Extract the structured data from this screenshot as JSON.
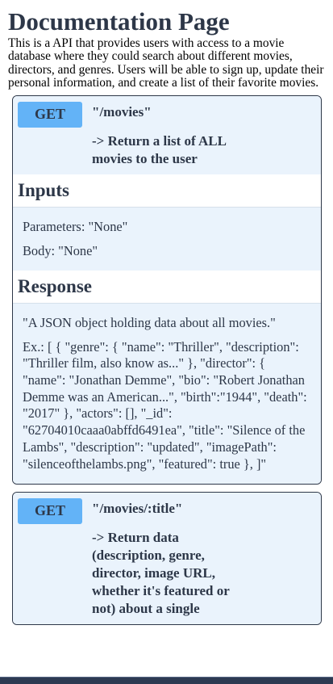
{
  "page": {
    "title": "Documentation Page",
    "intro": "This is a API that provides users with access to a movie database where they could search about different movies, directors, and genres. Users will be able to sign up, update their personal information, and create a list of their favorite movies."
  },
  "endpoints": [
    {
      "method": "GET",
      "path": "\"/movies\"",
      "description": "-> Return a list of ALL movies to the user",
      "inputs": {
        "title": "Inputs",
        "parameters": "Parameters: \"None\"",
        "body": "Body: \"None\""
      },
      "response": {
        "title": "Response",
        "summary": "\"A JSON object holding data about all movies.\"",
        "example": "Ex.: [ { \"genre\": { \"name\": \"Thriller\", \"description\": \"Thriller film, also know as...\" }, \"director\": { \"name\": \"Jonathan Demme\", \"bio\": \"Robert Jonathan Demme was an American...\", \"birth\":\"1944\", \"death\": \"2017\" }, \"actors\": [], \"_id\": \"62704010caaa0abffd6491ea\", \"title\": \"Silence of the Lambs\", \"description\": \"updated\", \"imagePath\": \"silenceofthelambs.png\", \"featured\": true }, ]\""
      }
    },
    {
      "method": "GET",
      "path": "\"/movies/:title\"",
      "description": "-> Return data (description, genre, director, image URL, whether it's featured or not) about a single"
    }
  ],
  "colors": {
    "heading": "#2d3748",
    "method_badge": "#63b3f7",
    "card_background": "#eaf3fc",
    "bottom_bar": "#2d3a52"
  }
}
